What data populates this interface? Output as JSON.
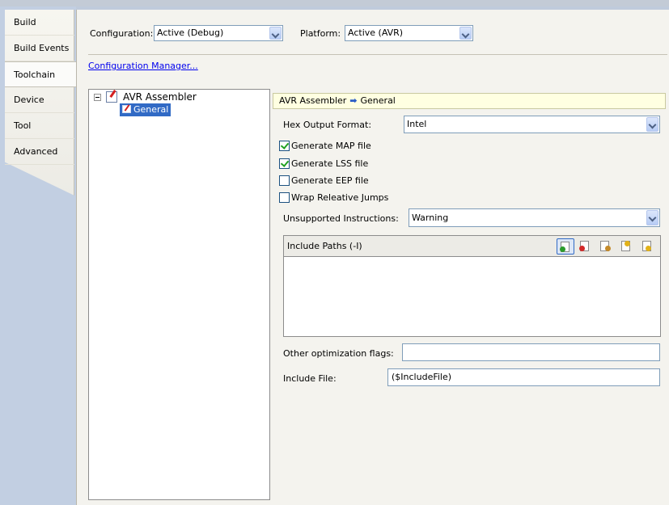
{
  "sidebar": {
    "items": [
      {
        "label": "Build"
      },
      {
        "label": "Build Events"
      },
      {
        "label": "Toolchain"
      },
      {
        "label": "Device"
      },
      {
        "label": "Tool"
      },
      {
        "label": "Advanced"
      }
    ],
    "active": "Toolchain"
  },
  "header": {
    "configuration_label": "Configuration:",
    "configuration_value": "Active (Debug)",
    "platform_label": "Platform:",
    "platform_value": "Active (AVR)",
    "config_manager_link": "Configuration Manager..."
  },
  "tree": {
    "root": "AVR Assembler",
    "child": "General"
  },
  "breadcrumb": {
    "parent": "AVR Assembler",
    "arrow": "➡",
    "current": "General"
  },
  "settings": {
    "hex_output_label": "Hex Output Format:",
    "hex_output_value": "Intel",
    "checkboxes": [
      {
        "label": "Generate MAP file",
        "checked": true
      },
      {
        "label": "Generate LSS file",
        "checked": true
      },
      {
        "label": "Generate EEP file",
        "checked": false
      },
      {
        "label": "Wrap Releative Jumps",
        "checked": false
      }
    ],
    "unsupported_label": "Unsupported Instructions:",
    "unsupported_value": "Warning",
    "include_paths_title": "Include Paths (-I)",
    "include_paths": [],
    "include_path_tools": [
      "add-path-icon",
      "delete-path-icon",
      "edit-path-icon",
      "move-up-icon",
      "move-down-icon"
    ],
    "other_flags_label": "Other optimization flags:",
    "other_flags_value": "",
    "include_file_label": "Include File:",
    "include_file_value": "($IncludeFile)"
  },
  "colors": {
    "selection": "#316ac5",
    "breadcrumb_bg": "#ffffe1",
    "check_mark": "#21a121"
  }
}
